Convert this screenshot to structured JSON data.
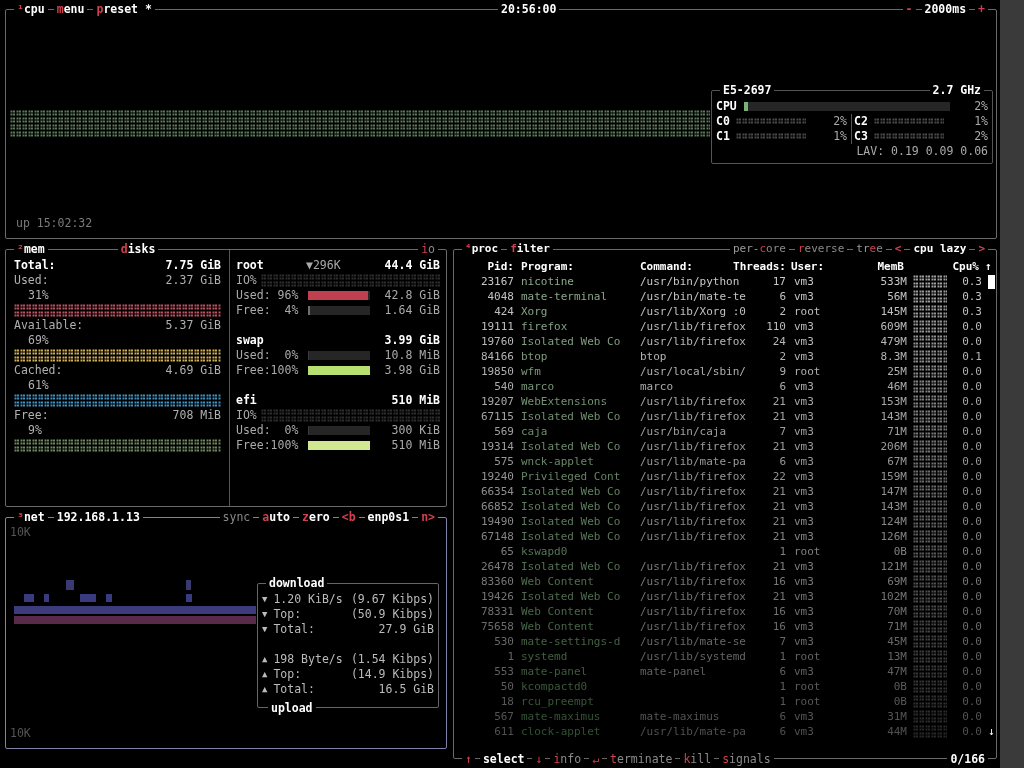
{
  "cpu_panel": {
    "tabs_left": [
      {
        "hotkey": "¹",
        "label": "cpu"
      },
      {
        "hotkey": "m",
        "label": "enu"
      },
      {
        "hotkey": "p",
        "label": "reset *"
      }
    ],
    "clock": "20:56:00",
    "tabs_right": [
      {
        "hotkey": "-"
      },
      {
        "label": "2000ms"
      },
      {
        "hotkey": "+"
      }
    ],
    "uptime": "up 15:02:32",
    "info": {
      "model": "E5-2697",
      "freq": "2.7 GHz",
      "total": {
        "label": "CPU",
        "level": 0.02,
        "reading": "2%"
      },
      "cores": [
        {
          "label": "C0",
          "reading": "2%"
        },
        {
          "label": "C1",
          "reading": "1%"
        },
        {
          "label": "C2",
          "reading": "1%"
        },
        {
          "label": "C3",
          "reading": "2%"
        }
      ],
      "load": "LAV: 0.19 0.09 0.06"
    }
  },
  "mem_panel": {
    "tabs_left": [
      {
        "hotkey": "²",
        "label": "mem"
      }
    ],
    "disks_tab": {
      "hotkey": "d",
      "label": "isks"
    },
    "io_tab": {
      "hotkey": "i",
      "label": "o"
    },
    "total": {
      "label": "Total:",
      "value": "7.75 GiB"
    },
    "items": [
      {
        "label": "Used:",
        "value": "2.37 GiB",
        "percent": "31%",
        "color": "#c05060"
      },
      {
        "label": "Available:",
        "value": "5.37 GiB",
        "percent": "69%",
        "color": "#d0b050"
      },
      {
        "label": "Cached:",
        "value": "4.69 GiB",
        "percent": "61%",
        "color": "#4090c0"
      },
      {
        "label": "Free:",
        "value": "708 MiB",
        "percent": "9%",
        "color": "#708860"
      }
    ],
    "disks": [
      {
        "name": "root",
        "io": "▼296K",
        "size": "44.4 GiB",
        "io_label": "IO%",
        "rows": [
          {
            "label": "Used: 96%",
            "level": 0.96,
            "color": "#c04050",
            "value": "42.8 GiB"
          },
          {
            "label": "Free:  4%",
            "level": 0.04,
            "color": "#707070",
            "value": "1.64 GiB"
          }
        ]
      },
      {
        "name": "swap",
        "size": "3.99 GiB",
        "rows": [
          {
            "label": "Used:  0%",
            "level": 0,
            "value": "10.8 MiB"
          },
          {
            "label": "Free:100%",
            "level": 1,
            "color": "#b8e070",
            "value": "3.98 GiB"
          }
        ]
      },
      {
        "name": "efi",
        "size": "510 MiB",
        "io_label": "IO%",
        "rows": [
          {
            "label": "Used:  0%",
            "level": 0,
            "value": "300 KiB"
          },
          {
            "label": "Free:100%",
            "level": 1,
            "color": "#d0e890",
            "value": "510 MiB"
          }
        ]
      }
    ]
  },
  "net_panel": {
    "tabs_left": [
      {
        "hotkey": "³",
        "label": "net"
      },
      {
        "label": "192.168.1.13"
      }
    ],
    "tabs_right": [
      {
        "label": "sync"
      },
      {
        "hotkey": "a",
        "label": "uto"
      },
      {
        "hotkey": "z",
        "label": "ero"
      },
      {
        "hotkey": "<b"
      },
      {
        "label": "enp0s1"
      },
      {
        "hotkey": "n>"
      }
    ],
    "scale_top": "10K",
    "scale_bottom": "10K",
    "download_title": "download",
    "upload_title": "upload",
    "download": [
      {
        "arrow": "▼",
        "label": "1.20 KiB/s",
        "value": "(9.67 Kibps)"
      },
      {
        "arrow": "▼",
        "label": "Top:",
        "value": "(50.9 Kibps)"
      },
      {
        "arrow": "▼",
        "label": "Total:",
        "value": "27.9 GiB"
      }
    ],
    "upload": [
      {
        "arrow": "▲",
        "label": "198 Byte/s",
        "value": "(1.54 Kibps)"
      },
      {
        "arrow": "▲",
        "label": "Top:",
        "value": "(14.9 Kibps)"
      },
      {
        "arrow": "▲",
        "label": "Total:",
        "value": "16.5 GiB"
      }
    ]
  },
  "proc_panel": {
    "tabs_left": [
      {
        "hotkey": "⁴",
        "label": "proc"
      },
      {
        "hotkey": "f",
        "label": "ilter"
      }
    ],
    "tabs_right": [
      {
        "pre": "per-",
        "hotkey": "c",
        "label": "ore"
      },
      {
        "hotkey": "r",
        "label": "everse"
      },
      {
        "pre": "tr",
        "hotkey": "e",
        "label": "e"
      },
      {
        "hotkey": "<"
      },
      {
        "label": "cpu lazy"
      },
      {
        "hotkey": ">"
      }
    ],
    "columns": [
      "Pid:",
      "Program:",
      "Command:",
      "Threads:",
      "User:",
      "MemB",
      "Cpu%"
    ],
    "scroll_up": "↑",
    "scroll_down": "↓",
    "rows": [
      {
        "pid": "23167",
        "program": "nicotine",
        "command": "/usr/bin/python",
        "threads": "17",
        "user": "vm3",
        "mem": "533M",
        "cpu": "0.3"
      },
      {
        "pid": "4048",
        "program": "mate-terminal",
        "command": "/usr/bin/mate-te",
        "threads": "6",
        "user": "vm3",
        "mem": "56M",
        "cpu": "0.3"
      },
      {
        "pid": "424",
        "program": "Xorg",
        "command": "/usr/lib/Xorg :0",
        "threads": "2",
        "user": "root",
        "mem": "145M",
        "cpu": "0.3"
      },
      {
        "pid": "19111",
        "program": "firefox",
        "command": "/usr/lib/firefox",
        "threads": "110",
        "user": "vm3",
        "mem": "609M",
        "cpu": "0.0"
      },
      {
        "pid": "19760",
        "program": "Isolated Web Co",
        "command": "/usr/lib/firefox",
        "threads": "24",
        "user": "vm3",
        "mem": "479M",
        "cpu": "0.0"
      },
      {
        "pid": "84166",
        "program": "btop",
        "command": "btop",
        "threads": "2",
        "user": "vm3",
        "mem": "8.3M",
        "cpu": "0.1"
      },
      {
        "pid": "19850",
        "program": "wfm",
        "command": "/usr/local/sbin/",
        "threads": "9",
        "user": "root",
        "mem": "25M",
        "cpu": "0.0"
      },
      {
        "pid": "540",
        "program": "marco",
        "command": "marco",
        "threads": "6",
        "user": "vm3",
        "mem": "46M",
        "cpu": "0.0"
      },
      {
        "pid": "19207",
        "program": "WebExtensions",
        "command": "/usr/lib/firefox",
        "threads": "21",
        "user": "vm3",
        "mem": "153M",
        "cpu": "0.0"
      },
      {
        "pid": "67115",
        "program": "Isolated Web Co",
        "command": "/usr/lib/firefox",
        "threads": "21",
        "user": "vm3",
        "mem": "143M",
        "cpu": "0.0"
      },
      {
        "pid": "569",
        "program": "caja",
        "command": "/usr/bin/caja",
        "threads": "7",
        "user": "vm3",
        "mem": "71M",
        "cpu": "0.0"
      },
      {
        "pid": "19314",
        "program": "Isolated Web Co",
        "command": "/usr/lib/firefox",
        "threads": "21",
        "user": "vm3",
        "mem": "206M",
        "cpu": "0.0"
      },
      {
        "pid": "575",
        "program": "wnck-applet",
        "command": "/usr/lib/mate-pa",
        "threads": "6",
        "user": "vm3",
        "mem": "67M",
        "cpu": "0.0"
      },
      {
        "pid": "19240",
        "program": "Privileged Cont",
        "command": "/usr/lib/firefox",
        "threads": "22",
        "user": "vm3",
        "mem": "159M",
        "cpu": "0.0"
      },
      {
        "pid": "66354",
        "program": "Isolated Web Co",
        "command": "/usr/lib/firefox",
        "threads": "21",
        "user": "vm3",
        "mem": "147M",
        "cpu": "0.0"
      },
      {
        "pid": "66852",
        "program": "Isolated Web Co",
        "command": "/usr/lib/firefox",
        "threads": "21",
        "user": "vm3",
        "mem": "143M",
        "cpu": "0.0"
      },
      {
        "pid": "19490",
        "program": "Isolated Web Co",
        "command": "/usr/lib/firefox",
        "threads": "21",
        "user": "vm3",
        "mem": "124M",
        "cpu": "0.0"
      },
      {
        "pid": "67148",
        "program": "Isolated Web Co",
        "command": "/usr/lib/firefox",
        "threads": "21",
        "user": "vm3",
        "mem": "126M",
        "cpu": "0.0"
      },
      {
        "pid": "65",
        "program": "kswapd0",
        "threads": "1",
        "user": "root",
        "mem": "0B",
        "cpu": "0.0"
      },
      {
        "pid": "26478",
        "program": "Isolated Web Co",
        "command": "/usr/lib/firefox",
        "threads": "21",
        "user": "vm3",
        "mem": "121M",
        "cpu": "0.0"
      },
      {
        "pid": "83360",
        "program": "Web Content",
        "command": "/usr/lib/firefox",
        "threads": "16",
        "user": "vm3",
        "mem": "69M",
        "cpu": "0.0"
      },
      {
        "pid": "19426",
        "program": "Isolated Web Co",
        "command": "/usr/lib/firefox",
        "threads": "21",
        "user": "vm3",
        "mem": "102M",
        "cpu": "0.0"
      },
      {
        "pid": "78331",
        "program": "Web Content",
        "command": "/usr/lib/firefox",
        "threads": "16",
        "user": "vm3",
        "mem": "70M",
        "cpu": "0.0"
      },
      {
        "pid": "75658",
        "program": "Web Content",
        "command": "/usr/lib/firefox",
        "threads": "16",
        "user": "vm3",
        "mem": "71M",
        "cpu": "0.0"
      },
      {
        "pid": "530",
        "program": "mate-settings-d",
        "command": "/usr/lib/mate-se",
        "threads": "7",
        "user": "vm3",
        "mem": "45M",
        "cpu": "0.0"
      },
      {
        "pid": "1",
        "program": "systemd",
        "command": "/usr/lib/systemd",
        "threads": "1",
        "user": "root",
        "mem": "13M",
        "cpu": "0.0"
      },
      {
        "pid": "553",
        "program": "mate-panel",
        "command": "mate-panel",
        "threads": "6",
        "user": "vm3",
        "mem": "47M",
        "cpu": "0.0"
      },
      {
        "pid": "50",
        "program": "kcompactd0",
        "threads": "1",
        "user": "root",
        "mem": "0B",
        "cpu": "0.0"
      },
      {
        "pid": "18",
        "program": "rcu_preempt",
        "threads": "1",
        "user": "root",
        "mem": "0B",
        "cpu": "0.0"
      },
      {
        "pid": "567",
        "program": "mate-maximus",
        "command": "mate-maximus",
        "threads": "6",
        "user": "vm3",
        "mem": "31M",
        "cpu": "0.0"
      },
      {
        "pid": "611",
        "program": "clock-applet",
        "command": "/usr/lib/mate-pa",
        "threads": "6",
        "user": "vm3",
        "mem": "44M",
        "cpu": "0.0"
      }
    ],
    "footer": [
      {
        "hotkey": "↑"
      },
      {
        "label": "select",
        "bold": true
      },
      {
        "hotkey": "↓"
      },
      {
        "hotkey": "i",
        "label": "nfo"
      },
      {
        "hotkey": "↵"
      },
      {
        "hotkey": "t",
        "label": "erminate"
      },
      {
        "hotkey": "k",
        "label": "ill"
      },
      {
        "hotkey": "s",
        "label": "ignals"
      }
    ],
    "count": "0/166"
  }
}
